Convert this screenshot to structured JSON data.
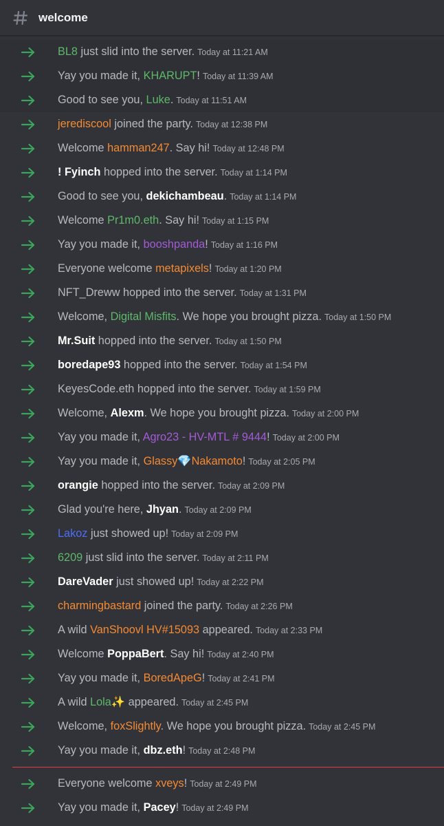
{
  "channel": {
    "name": "welcome"
  },
  "colors": {
    "arrow": "#3ba55c",
    "green": "#5fb86a",
    "orange": "#f48a34",
    "purple": "#a35bd6",
    "white": "#ffffff",
    "blue": "#4f6df5",
    "divider": "#e33f3f"
  },
  "messages": [
    {
      "before": "",
      "user": "BL8",
      "color": "green",
      "after": " just slid into the server.",
      "ts": "Today at 11:21 AM"
    },
    {
      "before": "Yay you made it, ",
      "user": "KHARUPT",
      "color": "green",
      "after": "!",
      "ts": "Today at 11:39 AM"
    },
    {
      "before": "Good to see you, ",
      "user": "Luke",
      "color": "green",
      "after": ".",
      "ts": "Today at 11:51 AM"
    },
    {
      "before": "",
      "user": "jerediscool",
      "color": "orange",
      "after": " joined the party.",
      "ts": "Today at 12:38 PM"
    },
    {
      "before": "Welcome ",
      "user": "hamman247",
      "color": "orange",
      "after": ". Say hi!",
      "ts": "Today at 12:48 PM"
    },
    {
      "before": "",
      "user": "! Fyinch",
      "color": "white",
      "after": " hopped into the server.",
      "ts": "Today at 1:14 PM"
    },
    {
      "before": "Good to see you, ",
      "user": "dekichambeau",
      "color": "white",
      "after": ".",
      "ts": "Today at 1:14 PM"
    },
    {
      "before": "Welcome ",
      "user": "Pr1m0.eth",
      "color": "green",
      "after": ". Say hi!",
      "ts": "Today at 1:15 PM"
    },
    {
      "before": "Yay you made it, ",
      "user": "booshpanda",
      "color": "purple",
      "after": "!",
      "ts": "Today at 1:16 PM"
    },
    {
      "before": "Everyone welcome ",
      "user": "metapixels",
      "color": "orange",
      "after": "!",
      "ts": "Today at 1:20 PM"
    },
    {
      "before": "",
      "user": "NFT_Dreww",
      "color": "default",
      "after": " hopped into the server.",
      "ts": "Today at 1:31 PM"
    },
    {
      "before": "Welcome, ",
      "user": "Digital Misfits",
      "color": "green",
      "after": ". We hope you brought pizza.",
      "ts": "Today at 1:50 PM"
    },
    {
      "before": "",
      "user": "Mr.Suit",
      "color": "white",
      "after": " hopped into the server.",
      "ts": "Today at 1:50 PM"
    },
    {
      "before": "",
      "user": "boredape93",
      "color": "white",
      "after": " hopped into the server.",
      "ts": "Today at 1:54 PM"
    },
    {
      "before": "",
      "user": "KeyesCode.eth",
      "color": "default",
      "after": " hopped into the server.",
      "ts": "Today at 1:59 PM"
    },
    {
      "before": "Welcome, ",
      "user": "Alexm",
      "color": "white",
      "after": ". We hope you brought pizza.",
      "ts": "Today at 2:00 PM"
    },
    {
      "before": "Yay you made it, ",
      "user": "Agro23 - HV-MTL # 9444",
      "color": "purple",
      "after": "!",
      "ts": "Today at 2:00 PM"
    },
    {
      "before": "Yay you made it, ",
      "user": "Glassy💎Nakamoto",
      "color": "orange",
      "after": "!",
      "ts": "Today at 2:05 PM"
    },
    {
      "before": "",
      "user": "orangie",
      "color": "white",
      "after": " hopped into the server.",
      "ts": "Today at 2:09 PM"
    },
    {
      "before": "Glad you're here, ",
      "user": "Jhyan",
      "color": "white",
      "after": ".",
      "ts": "Today at 2:09 PM"
    },
    {
      "before": "",
      "user": "Lakoz",
      "color": "blue",
      "after": " just showed up!",
      "ts": "Today at 2:09 PM"
    },
    {
      "before": "",
      "user": "6209",
      "color": "green",
      "after": " just slid into the server.",
      "ts": "Today at 2:11 PM"
    },
    {
      "before": "",
      "user": "DareVader",
      "color": "white",
      "after": " just showed up!",
      "ts": "Today at 2:22 PM"
    },
    {
      "before": "",
      "user": "charmingbastard",
      "color": "orange",
      "after": " joined the party.",
      "ts": "Today at 2:26 PM"
    },
    {
      "before": "A wild ",
      "user": "VanShoovl HV#15093",
      "color": "orange",
      "after": " appeared.",
      "ts": "Today at 2:33 PM"
    },
    {
      "before": "Welcome ",
      "user": "PoppaBert",
      "color": "white",
      "after": ". Say hi!",
      "ts": "Today at 2:40 PM"
    },
    {
      "before": "Yay you made it, ",
      "user": "BoredApeG",
      "color": "orange",
      "after": "!",
      "ts": "Today at 2:41 PM"
    },
    {
      "before": "A wild ",
      "user": "Lola✨",
      "color": "green",
      "after": " appeared.",
      "ts": "Today at 2:45 PM"
    },
    {
      "before": "Welcome, ",
      "user": "foxSlightly",
      "color": "orange",
      "after": ". We hope you brought pizza.",
      "ts": "Today at 2:45 PM"
    },
    {
      "before": "Yay you made it, ",
      "user": "dbz.eth",
      "color": "white",
      "after": "!",
      "ts": "Today at 2:48 PM"
    }
  ],
  "new_messages": [
    {
      "before": "Everyone welcome ",
      "user": "xveys",
      "color": "orange",
      "after": "!",
      "ts": "Today at 2:49 PM"
    },
    {
      "before": "Yay you made it, ",
      "user": "Pacey",
      "color": "white",
      "after": "!",
      "ts": "Today at 2:49 PM"
    }
  ]
}
